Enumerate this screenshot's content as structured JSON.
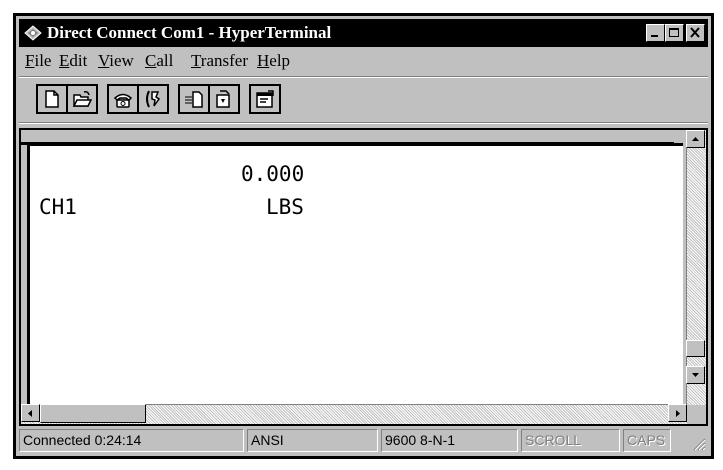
{
  "window": {
    "title": "Direct Connect Com1 - HyperTerminal",
    "app_icon": "hyperterminal-icon",
    "controls": [
      "minimize-icon",
      "maximize-icon",
      "close-icon"
    ]
  },
  "menu": {
    "items": [
      {
        "label": "File"
      },
      {
        "label": "Edit"
      },
      {
        "label": "View"
      },
      {
        "label": "Call"
      },
      {
        "label": "Transfer"
      },
      {
        "label": "Help"
      }
    ]
  },
  "toolbar": {
    "buttons": [
      "new-connection-icon",
      "open-icon",
      "call-icon",
      "disconnect-icon",
      "send-icon",
      "receive-icon",
      "properties-icon"
    ]
  },
  "terminal": {
    "lines": [
      {
        "text": "0.000"
      },
      {
        "left": "CH1",
        "right": "LBS"
      }
    ]
  },
  "status": {
    "connected": "Connected 0:24:14",
    "emulation": "ANSI",
    "port_settings": "9600 8-N-1",
    "scroll": "SCROLL",
    "caps": "CAPS"
  }
}
